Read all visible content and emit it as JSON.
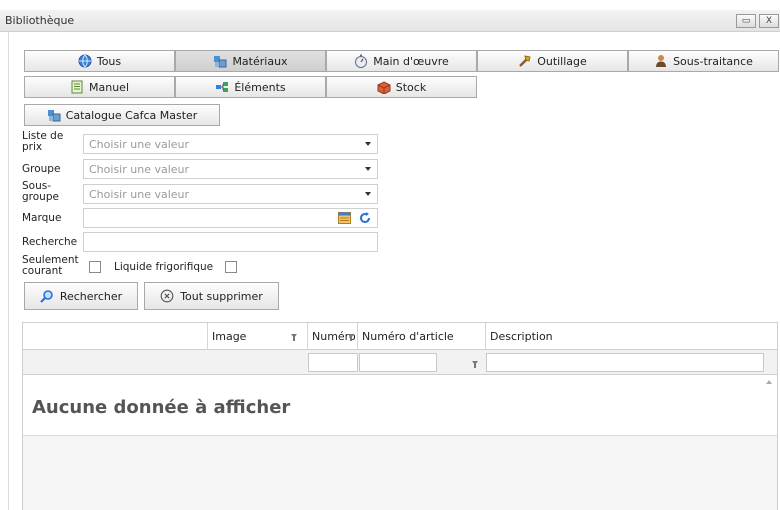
{
  "window": {
    "title": "Bibliothèque",
    "minimize_label": "▭",
    "close_label": "X"
  },
  "categories": [
    {
      "label": "Tous",
      "icon": "globe-icon"
    },
    {
      "label": "Matériaux",
      "icon": "materials-icon",
      "active": true
    },
    {
      "label": "Main d'œuvre",
      "icon": "stopwatch-icon"
    },
    {
      "label": "Outillage",
      "icon": "tools-icon"
    },
    {
      "label": "Sous-traitance",
      "icon": "person-icon"
    },
    {
      "label": "Manuel",
      "icon": "manual-icon"
    },
    {
      "label": "Éléments",
      "icon": "elements-icon"
    },
    {
      "label": "Stock",
      "icon": "stock-icon"
    },
    {
      "label": "Catalogue Cafca Master",
      "icon": "catalog-icon"
    }
  ],
  "filters": {
    "price_list_label": "Liste de prix",
    "price_list_placeholder": "Choisir une valeur",
    "group_label": "Groupe",
    "group_placeholder": "Choisir une valeur",
    "subgroup_label": "Sous-groupe",
    "subgroup_placeholder": "Choisir une valeur",
    "brand_label": "Marque",
    "brand_value": "",
    "search_label": "Recherche",
    "search_value": "",
    "current_only_label": "Seulement courant",
    "current_only_checked": false,
    "refrigerant_label": "Liquide frigorifique",
    "refrigerant_checked": false
  },
  "actions": {
    "search_label": "Rechercher",
    "clear_all_label": "Tout supprimer"
  },
  "grid": {
    "columns": [
      "",
      "Image",
      "Numéro",
      "Numéro d'article",
      "Description"
    ],
    "empty_text": "Aucune donnée à afficher"
  },
  "colors": {
    "button_border": "#a9a9a9",
    "active_button": "#d6d6d6",
    "placeholder": "#9a9a9a",
    "brand_icon_blue": "#2d6fd6"
  }
}
